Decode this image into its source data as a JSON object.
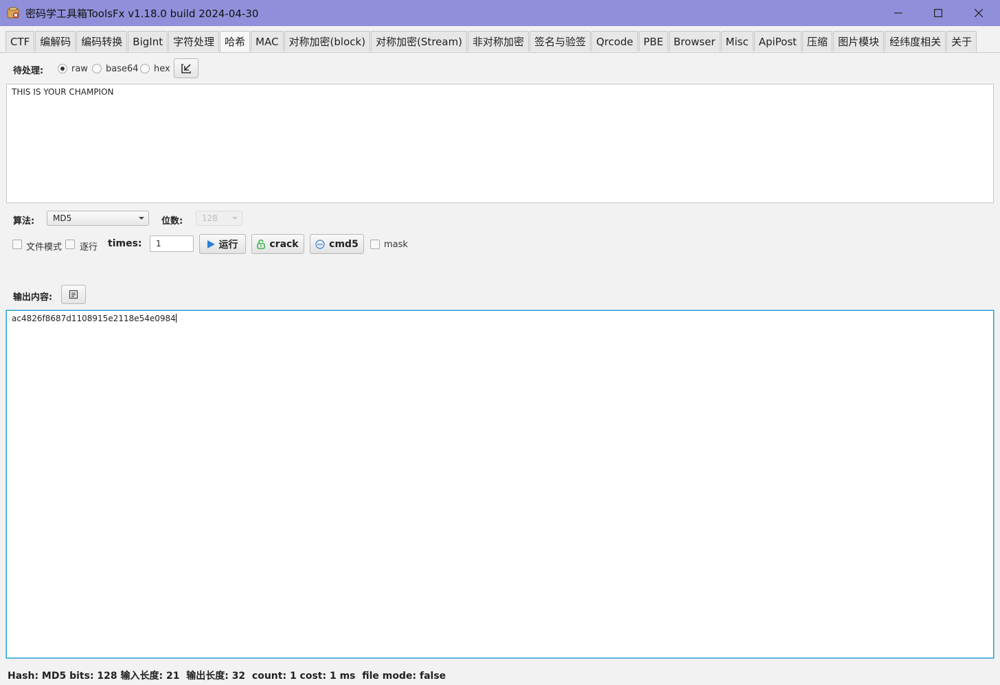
{
  "window": {
    "title": "密码学工具箱ToolsFx v1.18.0 build 2024-04-30",
    "accent_color": "#9090da"
  },
  "tabs": [
    {
      "label": "CTF"
    },
    {
      "label": "编解码"
    },
    {
      "label": "编码转换"
    },
    {
      "label": "BigInt"
    },
    {
      "label": "字符处理"
    },
    {
      "label": "哈希",
      "active": true
    },
    {
      "label": "MAC"
    },
    {
      "label": "对称加密(block)"
    },
    {
      "label": "对称加密(Stream)"
    },
    {
      "label": "非对称加密"
    },
    {
      "label": "签名与验签"
    },
    {
      "label": "Qrcode"
    },
    {
      "label": "PBE"
    },
    {
      "label": "Browser"
    },
    {
      "label": "Misc"
    },
    {
      "label": "ApiPost"
    },
    {
      "label": "压缩"
    },
    {
      "label": "图片模块"
    },
    {
      "label": "经纬度相关"
    },
    {
      "label": "关于"
    }
  ],
  "input_section": {
    "label": "待处理:",
    "encodings": [
      {
        "label": "raw",
        "selected": true
      },
      {
        "label": "base64",
        "selected": false
      },
      {
        "label": "hex",
        "selected": false
      }
    ],
    "import_icon": "import-file-icon",
    "text": "THIS IS YOUR CHAMPION"
  },
  "options": {
    "algorithm_label": "算法:",
    "algorithm_value": "MD5",
    "bits_label": "位数:",
    "bits_value": "128",
    "file_mode_label": "文件模式",
    "line_by_line_label": "逐行",
    "times_label": "times:",
    "times_value": "1",
    "run_label": "运行",
    "crack_label": "crack",
    "cmd5_label": "cmd5",
    "mask_label": "mask"
  },
  "output_section": {
    "label": "输出内容:",
    "copy_icon": "copy-icon",
    "text": "ac4826f8687d1108915e2118e54e0984"
  },
  "status_bar": {
    "text": "Hash: MD5 bits: 128 输入长度: 21  输出长度: 32  count: 1 cost: 1 ms  file mode: false"
  }
}
